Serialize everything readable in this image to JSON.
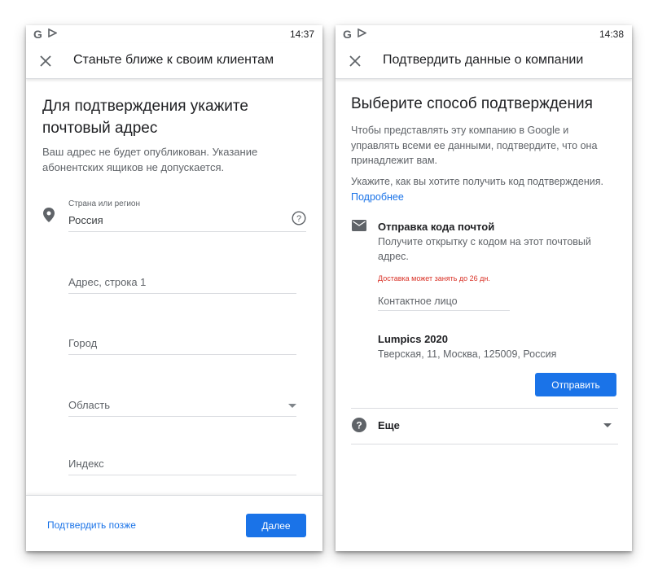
{
  "left_screen": {
    "status_bar": {
      "time": "14:37",
      "g_icon": "G"
    },
    "app_bar": {
      "title": "Станьте ближе к своим клиентам"
    },
    "heading": "Для подтверждения укажите почтовый адрес",
    "subtext": "Ваш адрес не будет опубликован. Указание абонентских ящиков не допускается.",
    "fields": {
      "country": {
        "label": "Страна или регион",
        "value": "Россия"
      },
      "address_line": {
        "placeholder": "Адрес, строка 1"
      },
      "city": {
        "placeholder": "Город"
      },
      "region": {
        "placeholder": "Область"
      },
      "postal": {
        "placeholder": "Индекс"
      }
    },
    "footer": {
      "later_link": "Подтвердить позже",
      "next_button": "Далее"
    }
  },
  "right_screen": {
    "status_bar": {
      "time": "14:38",
      "g_icon": "G"
    },
    "app_bar": {
      "title": "Подтвердить данные о компании"
    },
    "heading": "Выберите способ подтверждения",
    "paragraph1": "Чтобы представлять эту компанию в Google и управлять всеми ее данными, подтвердите, что она принадлежит вам.",
    "paragraph2": "Укажите, как вы хотите получить код подтверждения.",
    "learn_more_link": "Подробнее",
    "mail_method": {
      "title": "Отправка кода почтой",
      "description": "Получите открытку с кодом на этот почтовый адрес.",
      "warning": "Доставка может занять до 26 дн.",
      "contact_placeholder": "Контактное лицо",
      "business_name": "Lumpics 2020",
      "business_address": "Тверская, 11, Москва, 125009, Россия",
      "send_button": "Отправить"
    },
    "more": {
      "label": "Еще"
    }
  },
  "colors": {
    "accent": "#1a73e8",
    "warning": "#d93025",
    "divider": "#dadce0",
    "secondary_text": "#5f6368"
  },
  "icons": [
    "google-icon",
    "play-flag-icon",
    "close-icon",
    "location-pin-icon",
    "help-icon",
    "mail-icon",
    "dropdown-arrow-icon"
  ]
}
